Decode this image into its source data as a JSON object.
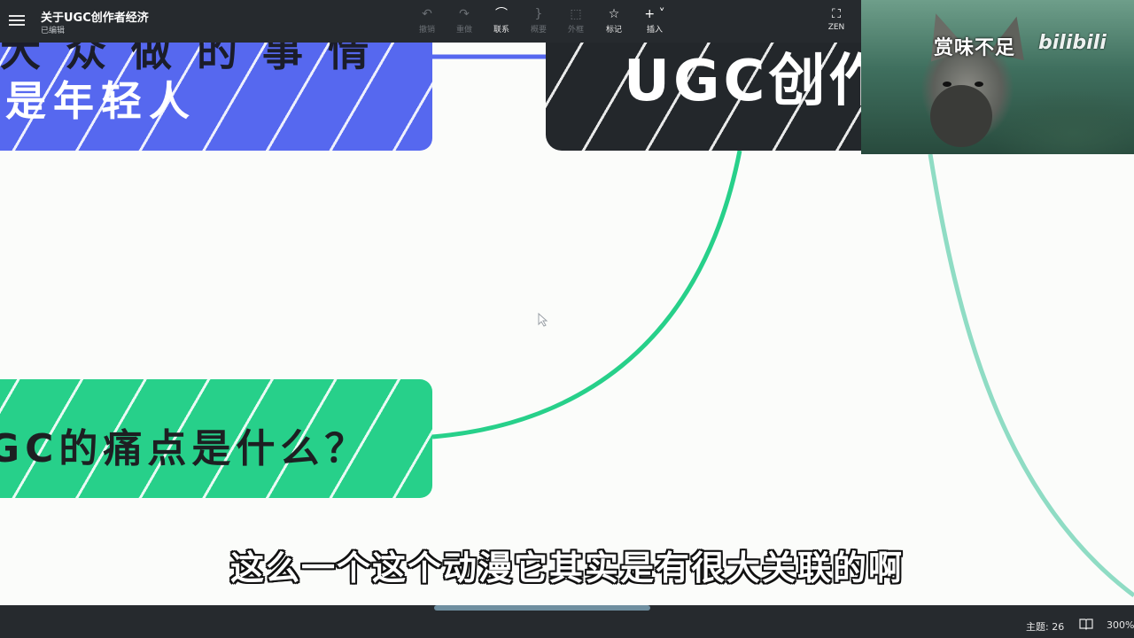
{
  "document": {
    "title": "关于UGC创作者经济",
    "status": "已编辑"
  },
  "toolbar": {
    "items": [
      {
        "label": "撤销",
        "icon": "undo-icon",
        "enabled": false
      },
      {
        "label": "重做",
        "icon": "redo-icon",
        "enabled": false
      },
      {
        "label": "联系",
        "icon": "relation-icon",
        "enabled": true
      },
      {
        "label": "概要",
        "icon": "summary-icon",
        "enabled": false
      },
      {
        "label": "外框",
        "icon": "boundary-icon",
        "enabled": false
      },
      {
        "label": "标记",
        "icon": "star-icon",
        "enabled": true
      },
      {
        "label": "插入",
        "icon": "plus-icon",
        "enabled": true
      },
      {
        "label": "ZEN",
        "icon": "fullscreen-icon",
        "enabled": true
      }
    ]
  },
  "canvas": {
    "nodes": {
      "blue": {
        "line1": "大 众 做 的 事 情",
        "line2": "是年轻人",
        "color": "#5668ef"
      },
      "dark": {
        "text": "UGC创作",
        "color": "#23272b"
      },
      "green": {
        "text": "GC的痛点是什么？",
        "color": "#27d08a"
      }
    },
    "connector_colors": {
      "blue": "#5668ef",
      "green": "#27d08a",
      "teal": "#8fdcc4"
    }
  },
  "video": {
    "caption": "赏味不足",
    "logo": "bilibili"
  },
  "subtitle": "这么一个这个动漫它其实是有很大关联的啊",
  "status_bar": {
    "topic_count": "主题: 26",
    "zoom": "300%"
  }
}
